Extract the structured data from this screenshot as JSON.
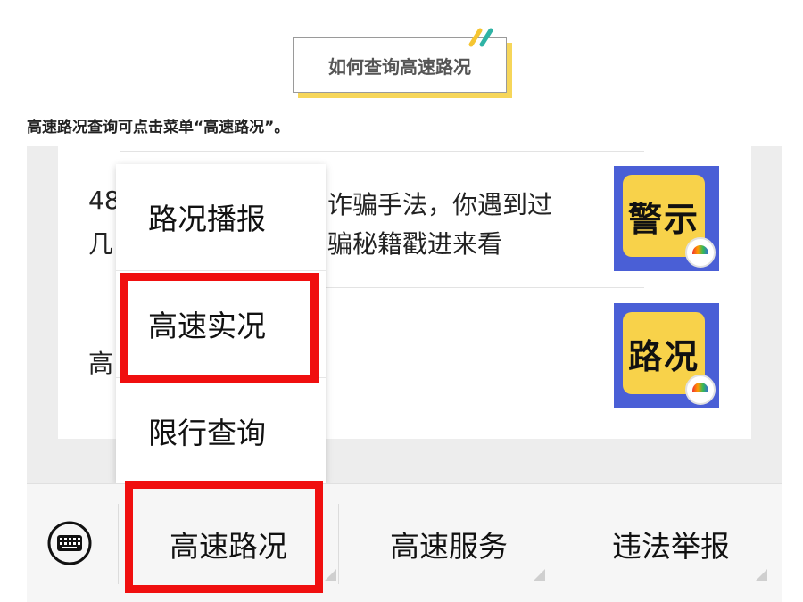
{
  "header": {
    "title": "如何查询高速路况"
  },
  "intro_text": "高速路况查询可点击菜单“高速路况”。",
  "feed": {
    "item1_line1_left": "48",
    "item1_line1_right": "诈骗手法，你遇到过",
    "item1_line2_left": "几",
    "item1_line2_right": "骗秘籍戳进来看",
    "item2_left": "高",
    "thumb1_label": "警示",
    "thumb2_label": "路况"
  },
  "popup_menu": {
    "items": [
      "路况播报",
      "高速实况",
      "限行查询"
    ]
  },
  "bottom_bar": {
    "keyboard_icon": "keyboard-icon",
    "menus": [
      "高速路况",
      "高速服务",
      "违法举报"
    ]
  },
  "colors": {
    "highlight": "#f00f0f",
    "thumb_bg": "#4a5fd6",
    "thumb_card": "#f8d24a",
    "title_shadow": "#f6d65a",
    "deco_yellow": "#f5c531",
    "deco_teal": "#2fb3a5"
  }
}
